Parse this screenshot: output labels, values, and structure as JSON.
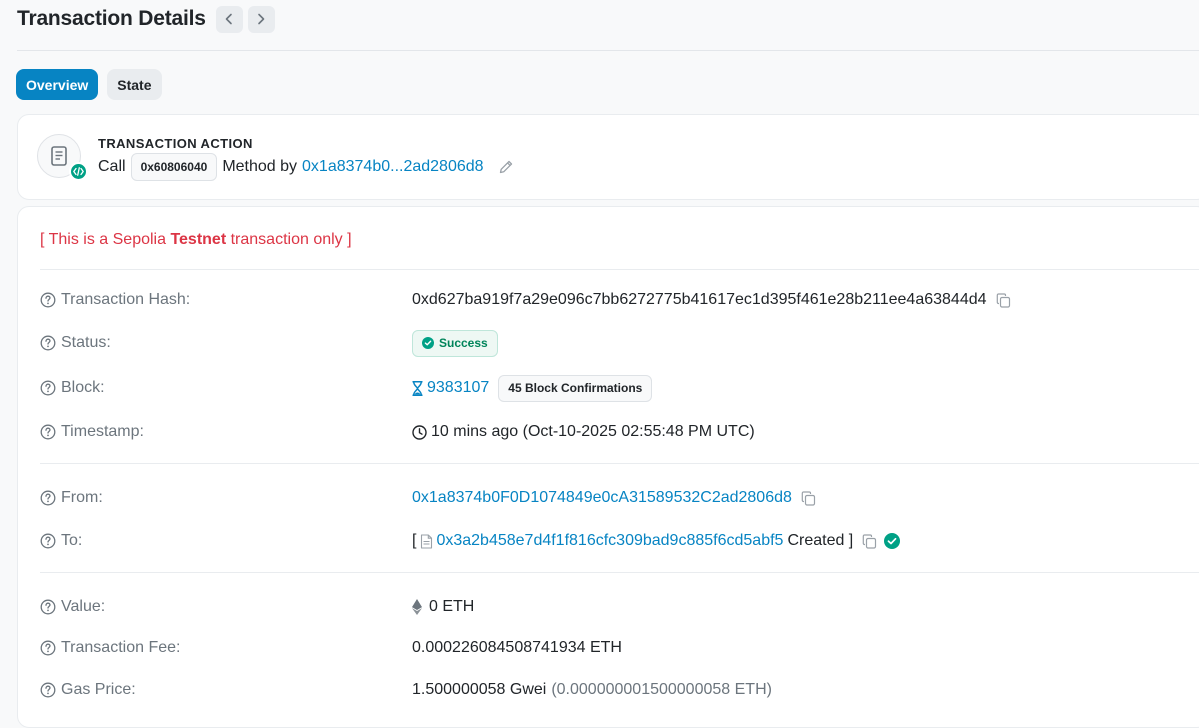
{
  "header": {
    "title": "Transaction Details"
  },
  "tabs": [
    {
      "label": "Overview",
      "active": true
    },
    {
      "label": "State",
      "active": false
    }
  ],
  "action": {
    "heading": "TRANSACTION ACTION",
    "call_label": "Call",
    "method_id": "0x60806040",
    "method_by_label": "Method by",
    "from_short": "0x1a8374b0...2ad2806d8"
  },
  "notice": {
    "prefix": "[ This is a Sepolia ",
    "emphasis": "Testnet",
    "suffix": " transaction only ]"
  },
  "details": {
    "hash": {
      "label": "Transaction Hash:",
      "value": "0xd627ba919f7a29e096c7bb6272775b41617ec1d395f461e28b211ee4a63844d4"
    },
    "status": {
      "label": "Status:",
      "value": "Success"
    },
    "block": {
      "label": "Block:",
      "number": "9383107",
      "confirmations": "45 Block Confirmations"
    },
    "timestamp": {
      "label": "Timestamp:",
      "value": "10 mins ago (Oct-10-2025 02:55:48 PM UTC)"
    },
    "from": {
      "label": "From:",
      "value": "0x1a8374b0F0D1074849e0cA31589532C2ad2806d8"
    },
    "to": {
      "label": "To:",
      "open_bracket": "[",
      "contract": "0x3a2b458e7d4f1f816cfc309bad9c885f6cd5abf5",
      "created": "Created ]"
    },
    "value": {
      "label": "Value:",
      "value": "0 ETH"
    },
    "fee": {
      "label": "Transaction Fee:",
      "value": "0.000226084508741934 ETH"
    },
    "gas_price": {
      "label": "Gas Price:",
      "gwei": "1.500000058 Gwei",
      "eth": "(0.000000001500000058 ETH)"
    }
  },
  "colors": {
    "accent": "#0784c3",
    "success": "#00a186",
    "danger": "#dc3545"
  }
}
